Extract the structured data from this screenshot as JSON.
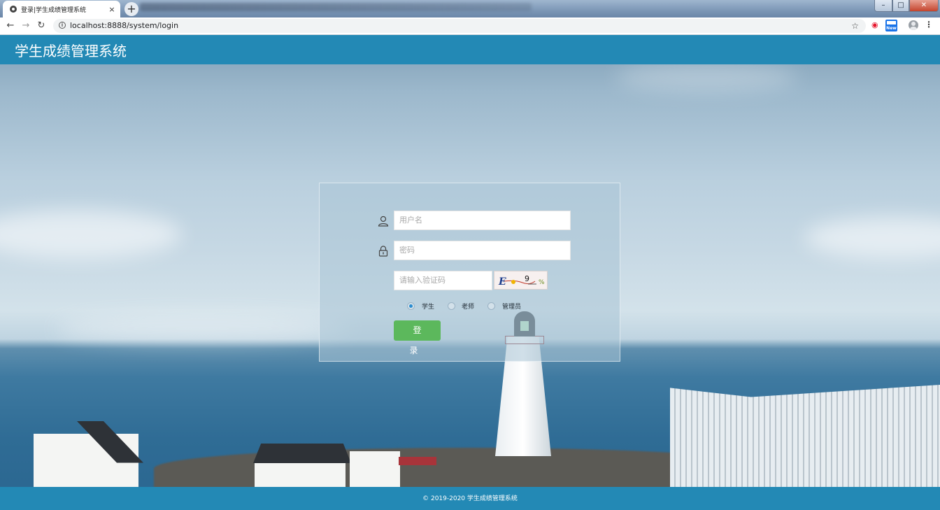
{
  "browser": {
    "tab_title": "登录|学生成绩管理系统",
    "tab_close": "×",
    "new_tab": "+",
    "url": "localhost:8888/system/login",
    "nav": {
      "back": "←",
      "forward": "→",
      "reload": "↻"
    },
    "window_controls": {
      "minimize": "–",
      "maximize": "□",
      "close": "✕"
    },
    "extensions": [
      "weibo-icon",
      "new-badge-icon"
    ],
    "menu": "⋮"
  },
  "header": {
    "title": "学生成绩管理系统",
    "background": "#2389b5"
  },
  "login": {
    "username_placeholder": "用户名",
    "password_placeholder": "密码",
    "captcha_placeholder": "请输入验证码",
    "captcha_text": "E  9",
    "roles": [
      {
        "label": "学生",
        "checked": true
      },
      {
        "label": "老师",
        "checked": false
      },
      {
        "label": "管理员",
        "checked": false
      }
    ],
    "submit_label": "登  录",
    "submit_color": "#5cb85c"
  },
  "footer": {
    "text": "© 2019-2020 学生成绩管理系统"
  }
}
